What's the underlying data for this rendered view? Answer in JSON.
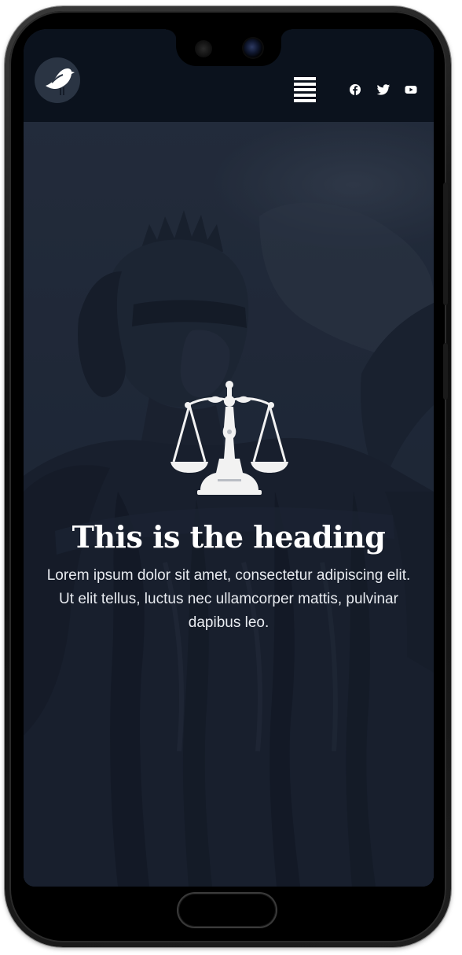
{
  "header": {
    "logo_icon": "bird-logo-icon",
    "menu_icon": "hamburger-menu-icon",
    "social": [
      {
        "name": "facebook",
        "icon": "facebook-icon"
      },
      {
        "name": "twitter",
        "icon": "twitter-icon"
      },
      {
        "name": "youtube",
        "icon": "youtube-icon"
      }
    ]
  },
  "hero": {
    "emblem_icon": "scales-of-justice-icon",
    "heading": "This is the heading",
    "text": "Lorem ipsum dolor sit amet, consectetur adipiscing elit. Ut elit tellus, luctus nec ullamcorper mattis, pulvinar dapibus leo."
  },
  "colors": {
    "header_bg": "#0b121d",
    "hero_tint": "#262f3f",
    "text": "#ffffff"
  }
}
